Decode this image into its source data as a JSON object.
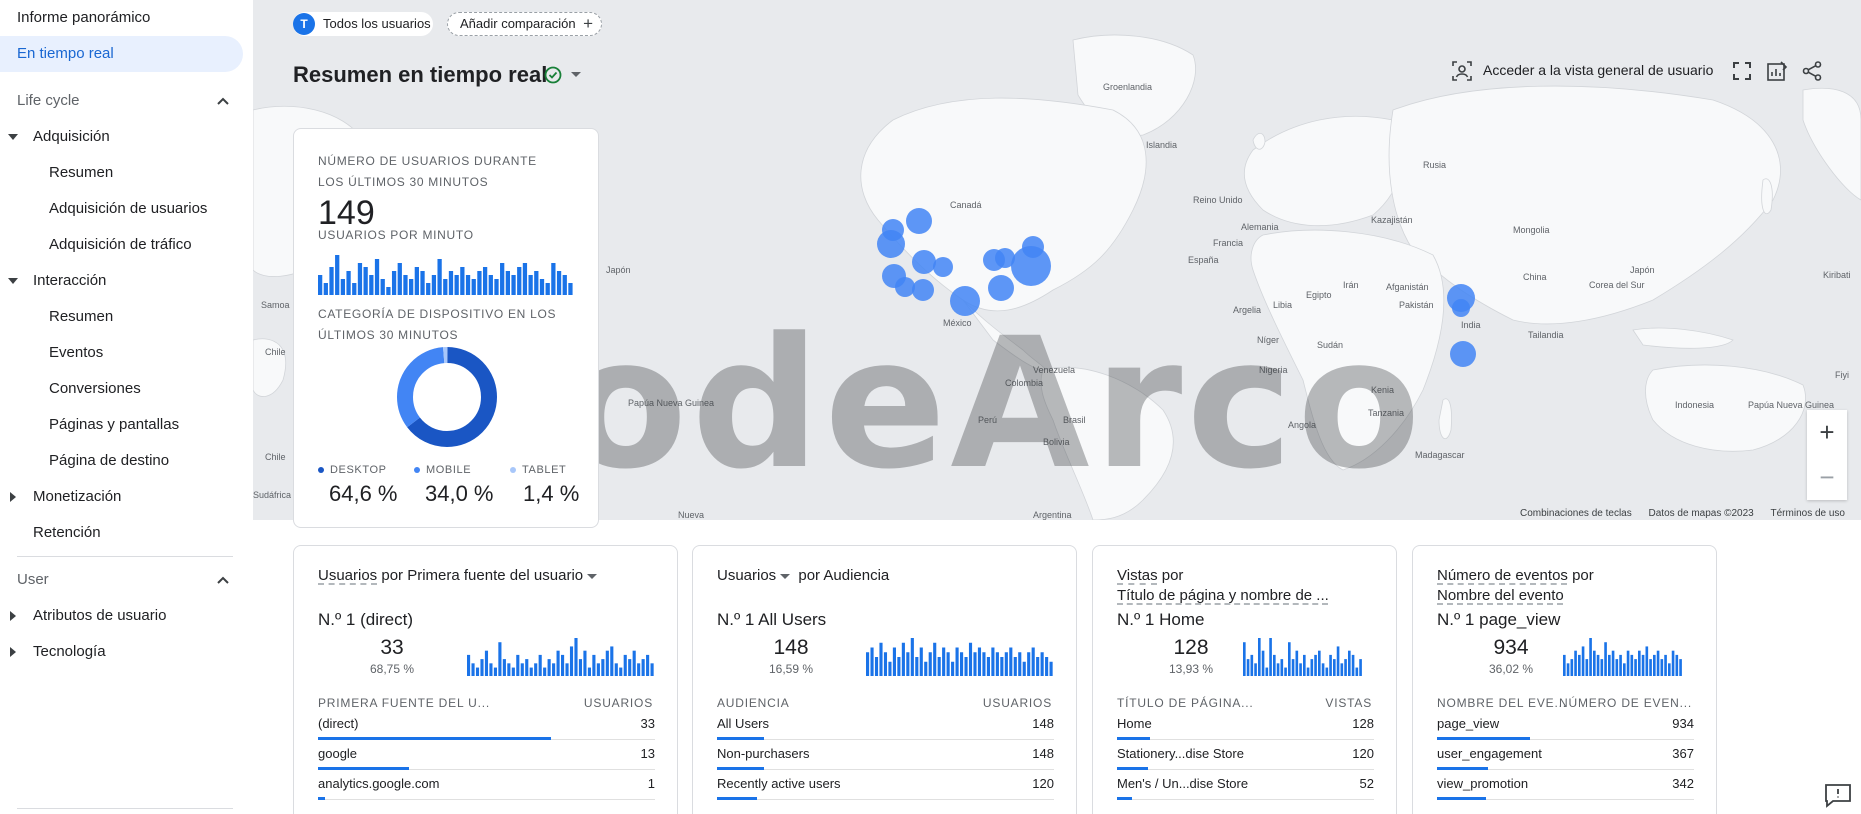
{
  "sidebar": {
    "items": [
      {
        "label": "Informe panorámico"
      },
      {
        "label": "En tiempo real"
      }
    ],
    "sections": {
      "lifecycle": "Life cycle",
      "user": "User"
    },
    "adquisicion": "Adquisición",
    "adq_items": [
      "Resumen",
      "Adquisición de usuarios",
      "Adquisición de tráfico"
    ],
    "interaccion": "Interacción",
    "int_items": [
      "Resumen",
      "Eventos",
      "Conversiones",
      "Páginas y pantallas",
      "Página de destino"
    ],
    "monetizacion": "Monetización",
    "retencion": "Retención",
    "atributos": "Atributos de usuario",
    "tecnologia": "Tecnología"
  },
  "header": {
    "user_chip_initial": "T",
    "user_chip": "Todos los usuarios",
    "compare_chip": "Añadir comparación",
    "title": "Resumen en tiempo real",
    "access_user": "Acceder a la vista general de usuario"
  },
  "map": {
    "labels": [
      {
        "text": "Groenlandia"
      },
      {
        "text": "Islandia"
      },
      {
        "text": "Canadá"
      },
      {
        "text": "Reino Unido"
      },
      {
        "text": "Alemania"
      },
      {
        "text": "Francia"
      },
      {
        "text": "España"
      },
      {
        "text": "Rusia"
      },
      {
        "text": "Kazajistán"
      },
      {
        "text": "Mongolia"
      },
      {
        "text": "China"
      },
      {
        "text": "Japón"
      },
      {
        "text": "Corea del Sur"
      },
      {
        "text": "Japón"
      },
      {
        "text": "Irán"
      },
      {
        "text": "Afganistán"
      },
      {
        "text": "Pakistán"
      },
      {
        "text": "India"
      },
      {
        "text": "Tailandia"
      },
      {
        "text": "Egipto"
      },
      {
        "text": "Argelia"
      },
      {
        "text": "Libia"
      },
      {
        "text": "Sudán"
      },
      {
        "text": "Níger"
      },
      {
        "text": "Nigeria"
      },
      {
        "text": "Kenia"
      },
      {
        "text": "Tanzania"
      },
      {
        "text": "Angola"
      },
      {
        "text": "Madagascar"
      },
      {
        "text": "Indonesia"
      },
      {
        "text": "Papúa Nueva Guinea"
      },
      {
        "text": "Papúa Nueva Guinea"
      },
      {
        "text": "México"
      },
      {
        "text": "Venezuela"
      },
      {
        "text": "Colombia"
      },
      {
        "text": "Perú"
      },
      {
        "text": "Brasil"
      },
      {
        "text": "Bolivia"
      },
      {
        "text": "Argentina"
      },
      {
        "text": "Chile"
      },
      {
        "text": "Chile"
      },
      {
        "text": "Sudáfrica"
      },
      {
        "text": "Nueva"
      },
      {
        "text": "Fiyi"
      },
      {
        "text": "Kiribati"
      },
      {
        "text": "Samoa"
      }
    ],
    "watermark": "codeArco",
    "footer": [
      "Combinaciones de teclas",
      "Datos de mapas ©2023",
      "Términos de uso"
    ],
    "zoom_in": "+",
    "zoom_out": "−"
  },
  "big_card": {
    "users_label": "NÚMERO DE USUARIOS DURANTE LOS ÚLTIMOS 30 MINUTOS",
    "users_value": "149",
    "per_minute_label": "USUARIOS POR MINUTO",
    "per_minute_values": [
      5,
      3,
      7,
      10,
      4,
      6,
      3,
      8,
      7,
      5,
      9,
      4,
      2,
      6,
      8,
      5,
      4,
      7,
      6,
      3,
      5,
      9,
      4,
      6,
      5,
      7,
      5,
      4,
      6,
      7,
      5,
      4,
      8,
      6,
      5,
      7,
      8,
      5,
      6,
      4,
      3,
      8,
      6,
      5,
      3
    ],
    "device_label": "CATEGORÍA DE DISPOSITIVO EN LOS ÚLTIMOS 30 MINUTOS",
    "devices": [
      {
        "name": "DESKTOP",
        "pct": "64,6 %",
        "value": 64.6,
        "color": "#1a56c4"
      },
      {
        "name": "MOBILE",
        "pct": "34,0 %",
        "value": 34.0,
        "color": "#4285f4"
      },
      {
        "name": "TABLET",
        "pct": "1,4 %",
        "value": 1.4,
        "color": "#a8c7fa"
      }
    ]
  },
  "cards": [
    {
      "title_a": "Usuarios",
      "title_b": " por Primera fuente del usuario",
      "rank": "N.º 1  (direct)",
      "value": "33",
      "sub": "68,75 %",
      "bars": [
        5,
        3,
        2,
        4,
        6,
        3,
        2,
        8,
        4,
        3,
        2,
        5,
        3,
        4,
        2,
        3,
        5,
        2,
        4,
        3,
        6,
        5,
        3,
        7,
        9,
        4,
        6,
        2,
        5,
        3,
        4,
        6,
        7,
        3,
        2,
        5,
        4,
        6,
        3,
        4,
        5,
        3
      ],
      "col1": "PRIMERA FUENTE DEL U...",
      "col2": "USUARIOS",
      "rows": [
        {
          "name": "(direct)",
          "val": "33",
          "frac": 0.69
        },
        {
          "name": "google",
          "val": "13",
          "frac": 0.27
        },
        {
          "name": "analytics.google.com",
          "val": "1",
          "frac": 0.02
        }
      ]
    },
    {
      "title_a": "Usuarios",
      "title_b": " por Audiencia",
      "rank": "N.º 1  All Users",
      "value": "148",
      "sub": "16,59 %",
      "bars": [
        5,
        6,
        4,
        7,
        5,
        3,
        6,
        4,
        7,
        5,
        8,
        4,
        6,
        3,
        5,
        7,
        4,
        6,
        5,
        3,
        6,
        5,
        4,
        7,
        5,
        6,
        5,
        4,
        6,
        5,
        4,
        5,
        6,
        4,
        5,
        3,
        5,
        6,
        4,
        5,
        4,
        3
      ],
      "col1": "AUDIENCIA",
      "col2": "USUARIOS",
      "rows": [
        {
          "name": "All Users",
          "val": "148",
          "frac": 0.14
        },
        {
          "name": "Non-purchasers",
          "val": "148",
          "frac": 0.14
        },
        {
          "name": "Recently active users",
          "val": "120",
          "frac": 0.12
        }
      ]
    },
    {
      "title_a": "Vistas",
      "title_b": " por",
      "title_c": "Título de página y nombre de ...",
      "rank": "N.º 1  Home",
      "value": "128",
      "sub": "13,93 %",
      "bars": [
        8,
        4,
        5,
        3,
        9,
        6,
        2,
        9,
        5,
        3,
        4,
        2,
        8,
        4,
        6,
        3,
        5,
        2,
        4,
        5,
        6,
        3,
        2,
        5,
        4,
        7,
        3,
        4,
        6,
        5,
        2,
        4
      ],
      "col1": "TÍTULO DE PÁGINA...",
      "col2": "VISTAS",
      "rows": [
        {
          "name": "Home",
          "val": "128",
          "frac": 0.13
        },
        {
          "name": "Stationery...dise Store",
          "val": "120",
          "frac": 0.12
        },
        {
          "name": "Men's / Un...dise Store",
          "val": "52",
          "frac": 0.06
        }
      ]
    },
    {
      "title_a": "Número de eventos",
      "title_b": " por",
      "title_c": "Nombre del evento",
      "rank": "N.º 1  page_view",
      "value": "934",
      "sub": "36,02 %",
      "bars": [
        5,
        3,
        4,
        6,
        5,
        7,
        4,
        9,
        6,
        5,
        4,
        8,
        5,
        6,
        4,
        5,
        3,
        6,
        5,
        4,
        6,
        5,
        7,
        4,
        5,
        6,
        4,
        5,
        3,
        6,
        5,
        4
      ],
      "col1": "NOMBRE DEL EVE...",
      "col2": "NÚMERO DE EVEN...",
      "rows": [
        {
          "name": "page_view",
          "val": "934",
          "frac": 0.36
        },
        {
          "name": "user_engagement",
          "val": "367",
          "frac": 0.2
        },
        {
          "name": "view_promotion",
          "val": "342",
          "frac": 0.19
        }
      ]
    }
  ],
  "colors": {
    "accent": "#1a73e8",
    "bubble": "#4285f4",
    "active_bg": "#e8f0fe",
    "ok": "#188038"
  }
}
